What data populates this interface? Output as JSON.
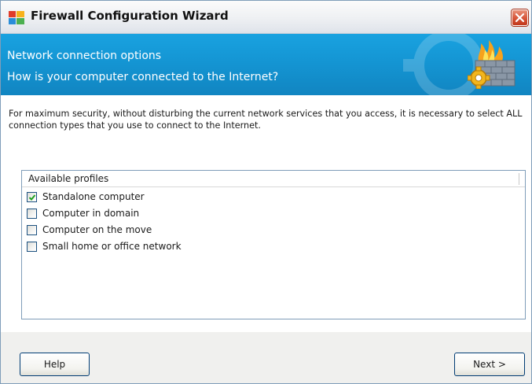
{
  "window": {
    "title": "Firewall Configuration Wizard"
  },
  "banner": {
    "heading": "Network connection options",
    "question": "How is your computer connected to the Internet?"
  },
  "description": "For maximum security, without disturbing the current network services that you access, it is necessary to select ALL connection types that you use to connect to the Internet.",
  "profiles": {
    "header": "Available profiles",
    "items": [
      {
        "label": "Standalone computer",
        "checked": true
      },
      {
        "label": "Computer in domain",
        "checked": false
      },
      {
        "label": "Computer on the move",
        "checked": false
      },
      {
        "label": "Small home or office network",
        "checked": false
      }
    ]
  },
  "buttons": {
    "help": "Help",
    "next": "Next >"
  },
  "colors": {
    "banner": "#1494d2",
    "close_button": "#d8593d",
    "checkmark": "#21a121",
    "border": "#7f9db9"
  },
  "icons": {
    "app": "avg-logo-icon",
    "close": "close-icon",
    "banner": "firewall-icon",
    "check": "checkmark-icon"
  }
}
